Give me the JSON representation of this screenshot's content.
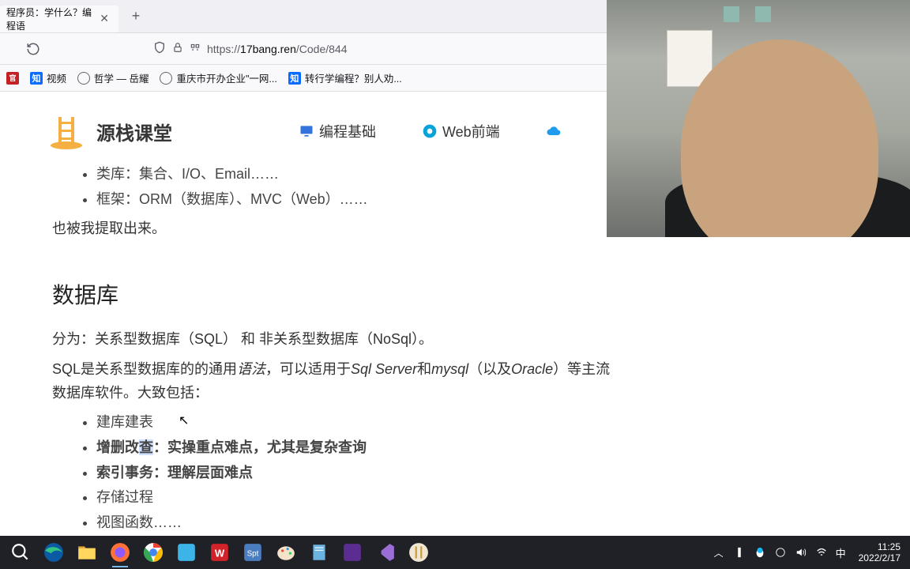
{
  "tab": {
    "title": "程序员：学什么？编程语"
  },
  "url": {
    "scheme": "https://",
    "host": "17bang.ren",
    "path": "/Code/844"
  },
  "bookmarks": [
    {
      "icon": "red",
      "glyph": "官",
      "label": ""
    },
    {
      "icon": "blue",
      "glyph": "知",
      "label": "视频"
    },
    {
      "icon": "globe",
      "glyph": "",
      "label": "哲学 — 岳耀"
    },
    {
      "icon": "globe",
      "glyph": "",
      "label": "重庆市开办企业\"一网..."
    },
    {
      "icon": "blue",
      "glyph": "知",
      "label": "转行学编程？别人劝..."
    }
  ],
  "site": {
    "title": "源栈课堂",
    "nav": [
      {
        "icon": "monitor",
        "label": "编程基础",
        "color": "#3273dc"
      },
      {
        "icon": "chrome",
        "label": "Web前端",
        "color": "#08a3d8"
      },
      {
        "icon": "cloud",
        "label": "",
        "color": "#209cee"
      }
    ]
  },
  "content": {
    "pre_list": [
      "类库：集合、I/O、Email……",
      "框架：ORM（数据库）、MVC（Web）……"
    ],
    "para_after": "也被我提取出来。",
    "h2": "数据库",
    "p1_a": "分为：关系型数据库（SQL） 和 非关系型数据库（NoSql）。",
    "p2_a": "SQL是关系型数据库的的通用",
    "p2_i": "语法",
    "p2_b": "，可以适用于",
    "p2_i2": "Sql Server",
    "p2_c": "和",
    "p2_i3": "mysql",
    "p2_d": "（以及",
    "p2_i4": "Oracle",
    "p2_e": "）等主流数据库软件。大致包括：",
    "list2": {
      "i0": "建库建表",
      "i1_a": "增删改",
      "i1_hl": "查",
      "i1_b": "：实操重点难点，尤其是复杂查询",
      "i2": "索引事务：理解层面难点",
      "i3": "存储过程",
      "i4": "视图函数……"
    }
  },
  "tray": {
    "ime": "中",
    "time": "11:25",
    "date": "2022/2/17"
  }
}
